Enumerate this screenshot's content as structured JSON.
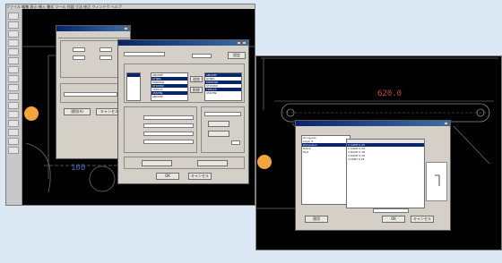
{
  "left_window": {
    "dimension_text": "100",
    "menubar_text": "ファイル 編集 表示 挿入 書式 ツール 作図 寸法 修正 ウィンドウ ヘルプ"
  },
  "right_window": {
    "dimension_text": "620.0"
  },
  "dialog_back": {
    "buttons": [
      "適用(A)",
      "キャンセル"
    ]
  },
  "dialog_front": {
    "buttons": [
      "設定",
      "追加",
      "削除",
      "OK",
      "キャンセル"
    ],
    "list_left_rows": [
      "ABCDEF",
      "GHIJKL",
      "MNOPQR",
      "STUVWX",
      "YZ0123",
      "456789",
      "ABCDEF"
    ],
    "list_right_rows": [
      "ABCDEF",
      "GHIJKL",
      "MNOPQR",
      "STUVWX",
      "YZ0123",
      "456789"
    ]
  },
  "dialog_right": {
    "tree_rows": [
      "All Layers",
      "Layer 0",
      "Dimension",
      "Hatch",
      "Text"
    ],
    "table_rows": [
      "0  CONT  0.25",
      "1  CONT  0.35",
      "2  DASH  0.18",
      "3  CONT  0.50",
      "4  CENT  0.25"
    ],
    "buttons": [
      "適用",
      "OK",
      "キャンセル"
    ]
  }
}
